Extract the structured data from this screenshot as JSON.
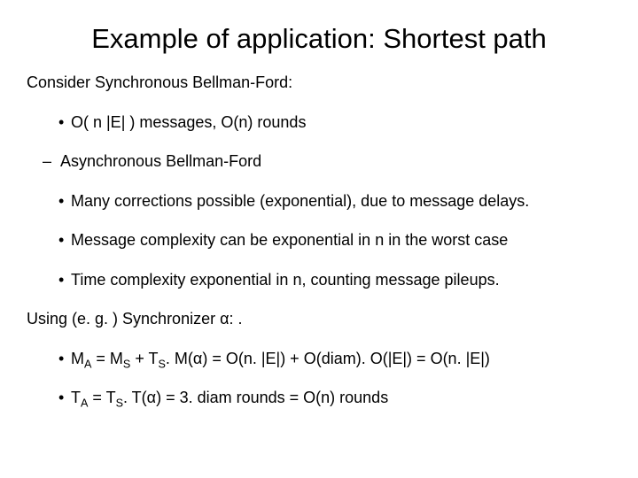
{
  "title": "Example of application: Shortest path",
  "l1": "Consider Synchronous Bellman-Ford:",
  "l2": "O( n |E| ) messages, O(n) rounds",
  "l3": "Asynchronous Bellman-Ford",
  "l4": "Many corrections possible (exponential), due to message delays.",
  "l5": "Message complexity can be exponential in n in the worst case",
  "l6": "Time complexity exponential in n, counting message pileups.",
  "l7": "Using (e. g. ) Synchronizer α: .",
  "l8_pre": "M",
  "l8_sub1": "A",
  "l8_mid1": " = M",
  "l8_sub2": "S",
  "l8_mid2": " + T",
  "l8_sub3": "S",
  "l8_post": ". M(α) = O(n. |E|) + O(diam). O(|E|) = O(n. |E|)",
  "l9_pre": "T",
  "l9_sub1": "A",
  "l9_mid1": " = T",
  "l9_sub2": "S",
  "l9_post": ". T(α) = 3. diam rounds = O(n) rounds"
}
